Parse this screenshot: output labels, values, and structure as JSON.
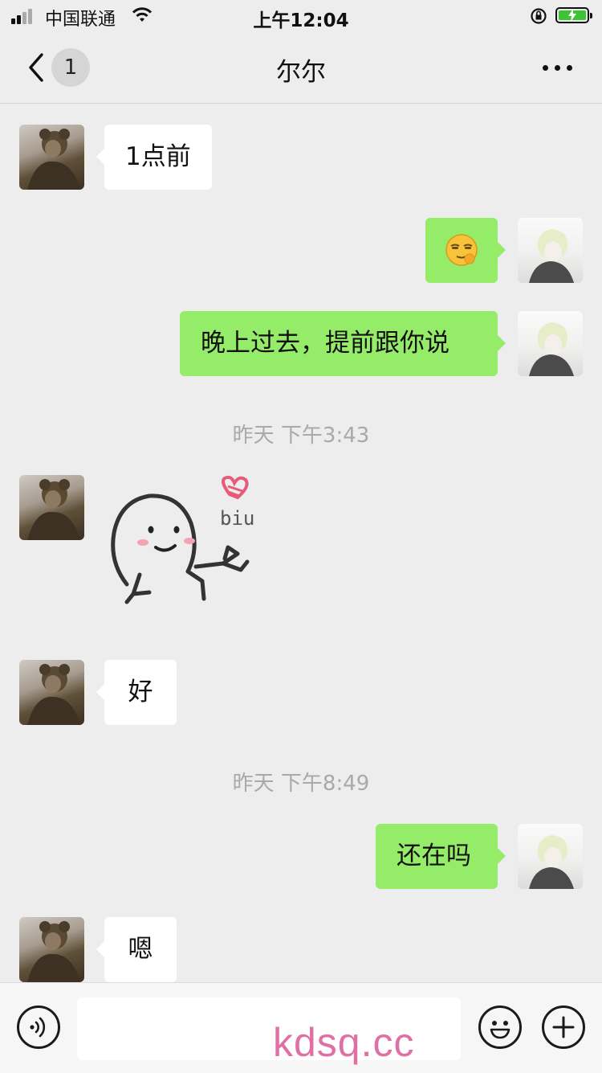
{
  "status_bar": {
    "carrier": "中国联通",
    "time": "上午12:04",
    "battery_level": 1.0
  },
  "nav": {
    "unread_count": "1",
    "title": "尔尔",
    "back_icon": "chevron-left-icon",
    "more_icon": "more-dots-icon"
  },
  "messages": [
    {
      "side": "in",
      "type": "text",
      "text": "1点前"
    },
    {
      "side": "out",
      "type": "emoji",
      "emoji": "smirk-emoji"
    },
    {
      "side": "out",
      "type": "text",
      "text": "晚上过去，提前跟你说"
    },
    {
      "type": "time",
      "text": "昨天 下午3:43"
    },
    {
      "side": "in",
      "type": "sticker",
      "caption": "biu"
    },
    {
      "side": "in",
      "type": "text",
      "text": "好"
    },
    {
      "type": "time",
      "text": "昨天 下午8:49"
    },
    {
      "side": "out",
      "type": "text",
      "text": "还在吗"
    },
    {
      "side": "in",
      "type": "text",
      "text": "嗯"
    }
  ],
  "input_bar": {
    "voice_icon": "voice-icon",
    "emoji_icon": "emoji-icon",
    "plus_icon": "plus-icon"
  },
  "watermark": "kdsq.cc",
  "colors": {
    "background": "#ededed",
    "outgoing_bubble": "#95ec69",
    "incoming_bubble": "#ffffff",
    "timestamp": "#a9a9a9",
    "watermark": "#e06fa6"
  }
}
